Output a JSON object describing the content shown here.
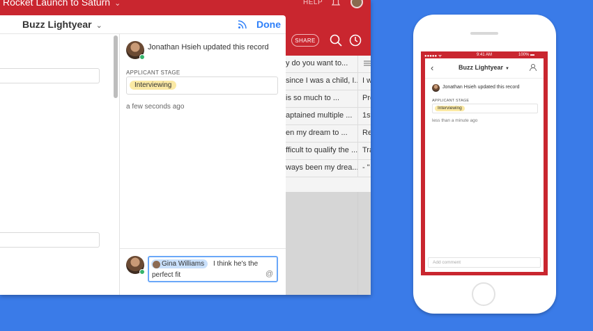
{
  "desktop": {
    "base_title": "Rocket Launch to Saturn",
    "help_label": "HELP",
    "share_label": "SHARE",
    "grid_rows": [
      {
        "c1": "y do you want to...",
        "c2": ""
      },
      {
        "c1": "since I was a child, I...",
        "c2": "I w"
      },
      {
        "c1": "is so much to ...",
        "c2": "Pre"
      },
      {
        "c1": "aptained multiple ...",
        "c2": "1st"
      },
      {
        "c1": "en my dream to ...",
        "c2": "Re"
      },
      {
        "c1": "fficult to qualify the ...",
        "c2": "Tra"
      },
      {
        "c1": "ways been my drea...",
        "c2": "- \""
      }
    ],
    "record": {
      "title": "Buzz Lightyear",
      "done_label": "Done"
    },
    "activity": {
      "text": "Jonathan Hsieh updated this record",
      "field_label": "APPLICANT STAGE",
      "stage_value": "Interviewing",
      "time": "a few seconds ago"
    },
    "comment": {
      "mention": "Gina Williams",
      "text_line1": "I think he's the",
      "text_line2": "perfect fit",
      "at_symbol": "@"
    }
  },
  "mobile": {
    "status_left": "●●●●● ᯤ",
    "status_time": "9:41 AM",
    "status_right": "100% ▬",
    "back_icon": "‹",
    "title": "Buzz Lightyear",
    "activity_text": "Jonathan Hsieh updated this record",
    "field_label": "APPLICANT STAGE",
    "stage_value": "Interviewing",
    "time": "less than a minute ago",
    "comment_placeholder": "Add comment"
  },
  "colors": {
    "brand_red": "#c9262f",
    "background_blue": "#3a7be8",
    "accent_blue": "#2d7ff9",
    "pill_yellow": "#fbe9a4",
    "mention_blue": "#c9e0fb"
  }
}
